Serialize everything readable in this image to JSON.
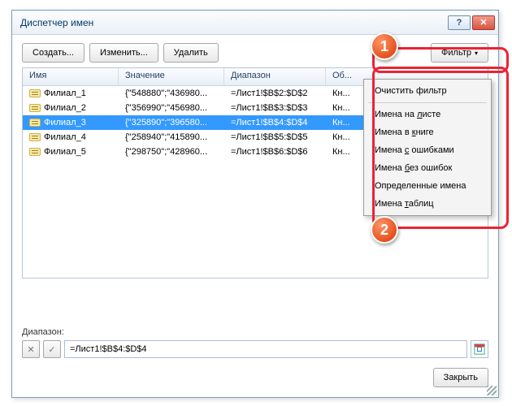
{
  "window": {
    "title": "Диспетчер имен",
    "help": "?",
    "close": "✕"
  },
  "toolbar": {
    "create": "Создать...",
    "edit": "Изменить...",
    "delete": "Удалить",
    "filter": "Фильтр",
    "filter_tri": "▾"
  },
  "columns": {
    "name": "Имя",
    "value": "Значение",
    "ref": "Диапазон",
    "scope": "Об..."
  },
  "rows": [
    {
      "name": "Филиал_1",
      "value": "{\"548880\";\"436980...",
      "ref": "=Лист1!$B$2:$D$2",
      "scope": "Кн..."
    },
    {
      "name": "Филиал_2",
      "value": "{\"356990\";\"456980...",
      "ref": "=Лист1!$B$3:$D$3",
      "scope": "Кн..."
    },
    {
      "name": "Филиал_3",
      "value": "{\"325890\";\"396580...",
      "ref": "=Лист1!$B$4:$D$4",
      "scope": "Кн...",
      "selected": true
    },
    {
      "name": "Филиал_4",
      "value": "{\"258940\";\"415890...",
      "ref": "=Лист1!$B$5:$D$5",
      "scope": "Кн..."
    },
    {
      "name": "Филиал_5",
      "value": "{\"298750\";\"428960...",
      "ref": "=Лист1!$B$6:$D$6",
      "scope": "Кн..."
    }
  ],
  "menu": {
    "clear": "Очистить фильтр",
    "sheet_pre": "Имена на ",
    "sheet_u": "л",
    "sheet_post": "исте",
    "book_pre": "Имена в ",
    "book_u": "к",
    "book_post": "ниге",
    "err_pre": "Имена ",
    "err_u": "с",
    "err_post": " ошибками",
    "noerr_pre": "Имена ",
    "noerr_u": "б",
    "noerr_post": "ез ошибок",
    "defined": "Определенные имена",
    "tbl_pre": "Имена ",
    "tbl_u": "т",
    "tbl_post": "аблиц"
  },
  "ref": {
    "label": "Диапазон:",
    "value": "=Лист1!$B$4:$D$4",
    "cancel": "✕",
    "apply": "✓"
  },
  "close_btn": "Закрыть",
  "badges": {
    "one": "1",
    "two": "2"
  }
}
